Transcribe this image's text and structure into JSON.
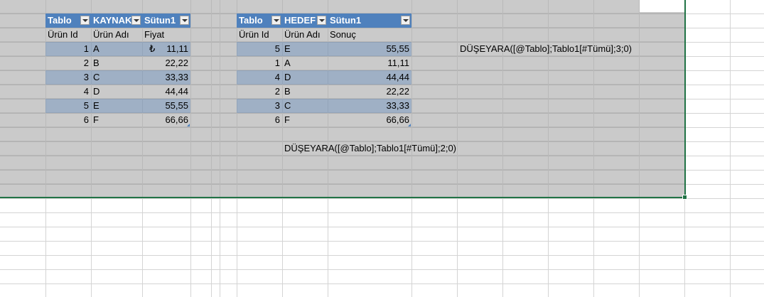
{
  "left_table": {
    "headers": [
      "Tablo",
      "KAYNAK",
      "Sütun1"
    ],
    "subheaders": [
      "Ürün Id",
      "Ürün Adı",
      "Fiyat"
    ],
    "rows": [
      {
        "id": "1",
        "name": "A",
        "currency": "₺",
        "value": "11,11"
      },
      {
        "id": "2",
        "name": "B",
        "currency": "",
        "value": "22,22"
      },
      {
        "id": "3",
        "name": "C",
        "currency": "",
        "value": "33,33"
      },
      {
        "id": "4",
        "name": "D",
        "currency": "",
        "value": "44,44"
      },
      {
        "id": "5",
        "name": "E",
        "currency": "",
        "value": "55,55"
      },
      {
        "id": "6",
        "name": "F",
        "currency": "",
        "value": "66,66"
      }
    ]
  },
  "right_table": {
    "headers": [
      "Tablo",
      "HEDEF",
      "Sütun1"
    ],
    "subheaders": [
      "Ürün Id",
      "Ürün Adı",
      "Sonuç"
    ],
    "rows": [
      {
        "id": "5",
        "name": "E",
        "value": "55,55"
      },
      {
        "id": "1",
        "name": "A",
        "value": "11,11"
      },
      {
        "id": "4",
        "name": "D",
        "value": "44,44"
      },
      {
        "id": "2",
        "name": "B",
        "value": "22,22"
      },
      {
        "id": "3",
        "name": "C",
        "value": "33,33"
      },
      {
        "id": "6",
        "name": "F",
        "value": "66,66"
      }
    ]
  },
  "formulas": {
    "right_note": "DÜŞEYARA([@Tablo];Tablo1[#Tümü];3;0)",
    "bottom_note": "DÜŞEYARA([@Tablo];Tablo1[#Tümü];2;0)"
  },
  "colors": {
    "header": "#4f81bd",
    "selection_border": "#217346"
  }
}
